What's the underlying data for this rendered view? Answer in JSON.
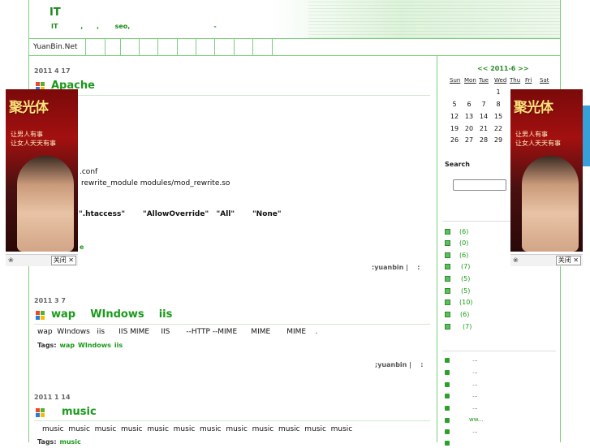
{
  "header": {
    "title": "IT",
    "subtitle": "IT          ,      ,       seo,                                     -"
  },
  "nav": {
    "home": "YuanBin.Net"
  },
  "posts": [
    {
      "date": "2011  4  17",
      "title": "Apache",
      "lines": [
        ".conf",
        "rewrite_module modules/mod_rewrite.so"
      ],
      "bold_line": "\".htaccess\"       \"AllowOverride\"   \"All\"       \"None\"",
      "more": "e",
      "meta": ":yuanbin |    :"
    },
    {
      "date": "2011  3  7",
      "title": "wap    WIndows    iis",
      "body": "wap  WIndows   iis      IIS MIME     IIS       --HTTP --MIME      MIME       MIME    .",
      "tags_label": "Tags:",
      "tags": [
        "wap",
        "WIndows",
        "iis"
      ],
      "meta": ";yuanbin |    :"
    },
    {
      "date": "2011  1  14",
      "title": "music",
      "body": "music  music  music  music  music  music  music  music  music  music  music  music",
      "tags_label": "Tags:",
      "tags": [
        "music"
      ]
    }
  ],
  "calendar": {
    "title": "<< 2011-6 >>",
    "headers": [
      "Sun",
      "Mon",
      "Tue",
      "Wed",
      "Thu",
      "Fri",
      "Sat"
    ],
    "days": [
      "1",
      "5",
      "6",
      "7",
      "8",
      "12",
      "13",
      "14",
      "15",
      "19",
      "20",
      "21",
      "22",
      "26",
      "27",
      "28",
      "29"
    ]
  },
  "search": {
    "label": "Search",
    "value": ""
  },
  "categories": [
    "(6)",
    "(0)",
    "(6)",
    "(7)",
    "(5)",
    "(5)",
    "(10)",
    "(6)",
    "(7)"
  ],
  "recent": [
    "...",
    "...",
    "...",
    "...",
    "...",
    "ww...",
    "..."
  ],
  "ads": {
    "title": "聚光体",
    "slogan": "让男人有事\n让女人天天有事",
    "close_label": "关闭",
    "close_glyph": "✕",
    "logo_glyph": "❀"
  },
  "colors": {
    "accent": "#1a9a1a",
    "border": "#7ccf7c"
  }
}
